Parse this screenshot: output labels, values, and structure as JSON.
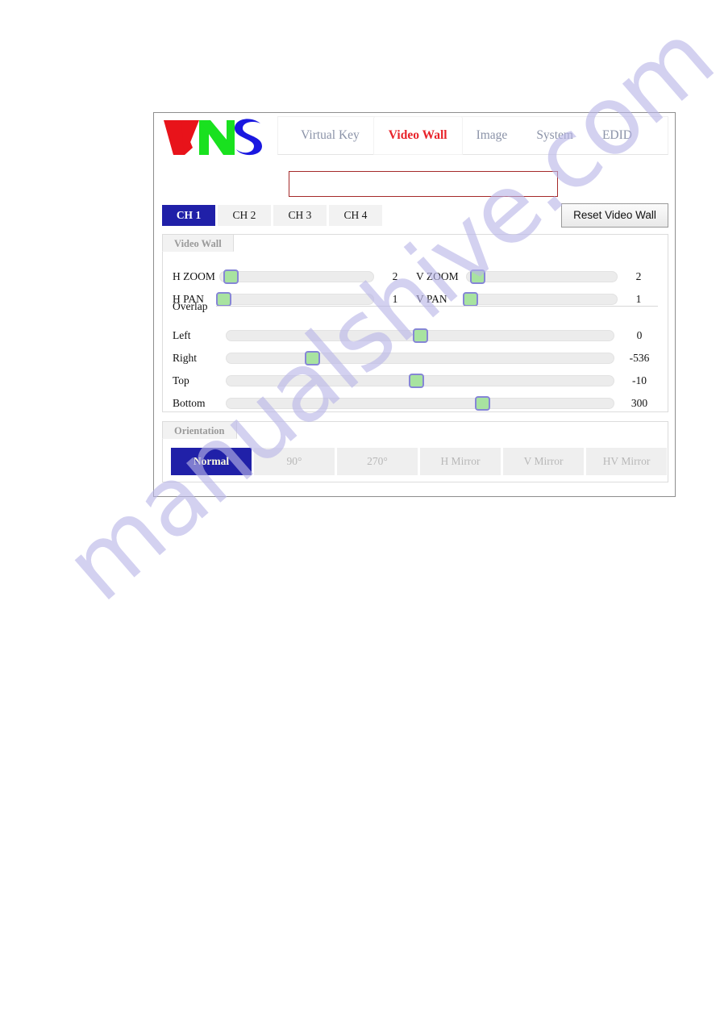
{
  "brand": {
    "logo_text": "VNS",
    "logo_colors": {
      "v": "#e8131a",
      "n": "#19e11f",
      "s": "#1a18e0"
    }
  },
  "nav": {
    "items": [
      {
        "label": "Virtual Key",
        "active": false
      },
      {
        "label": "Video Wall",
        "active": true
      },
      {
        "label": "Image",
        "active": false
      },
      {
        "label": "System",
        "active": false
      },
      {
        "label": "EDID",
        "active": false
      }
    ],
    "active_color": "#e8232a",
    "inactive_color": "#8b93a8"
  },
  "status_box": {
    "value": "",
    "placeholder": "",
    "border_color": "#a52a2a"
  },
  "channels": {
    "tabs": [
      {
        "label": "CH 1",
        "active": true
      },
      {
        "label": "CH 2",
        "active": false
      },
      {
        "label": "CH 3",
        "active": false
      },
      {
        "label": "CH 4",
        "active": false
      }
    ],
    "active_color": "#2020a8",
    "reset_label": "Reset Video Wall"
  },
  "video_wall": {
    "legend": "Video Wall",
    "overlap_label": "Overlap",
    "sliders": [
      {
        "label": "H ZOOM",
        "value": "2",
        "percent": 7,
        "column": "left",
        "group": "zoom"
      },
      {
        "label": "V ZOOM",
        "value": "2",
        "percent": 7,
        "column": "right",
        "group": "zoom"
      },
      {
        "label": "H PAN",
        "value": "1",
        "percent": 2,
        "column": "left",
        "group": "pan"
      },
      {
        "label": "V PAN",
        "value": "1",
        "percent": 2,
        "column": "right",
        "group": "pan"
      },
      {
        "label": "Left",
        "value": "0",
        "percent": 50,
        "column": "full",
        "group": "overlap"
      },
      {
        "label": "Right",
        "value": "-536",
        "percent": 22,
        "column": "full",
        "group": "overlap"
      },
      {
        "label": "Top",
        "value": "-10",
        "percent": 49,
        "column": "full",
        "group": "overlap"
      },
      {
        "label": "Bottom",
        "value": "300",
        "percent": 66,
        "column": "full",
        "group": "overlap"
      }
    ],
    "knob_fill": "#a8e3a0",
    "knob_border": "#8686d6",
    "track_color": "#ececec"
  },
  "orientation": {
    "legend": "Orientation",
    "buttons": [
      {
        "label": "Normal",
        "active": true
      },
      {
        "label": "90°",
        "active": false
      },
      {
        "label": "270°",
        "active": false
      },
      {
        "label": "H Mirror",
        "active": false
      },
      {
        "label": "V Mirror",
        "active": false
      },
      {
        "label": "HV Mirror",
        "active": false
      }
    ],
    "active_color": "#2020a8"
  },
  "watermark": {
    "text": "manualshive.com",
    "color": "#b9b6e8"
  }
}
